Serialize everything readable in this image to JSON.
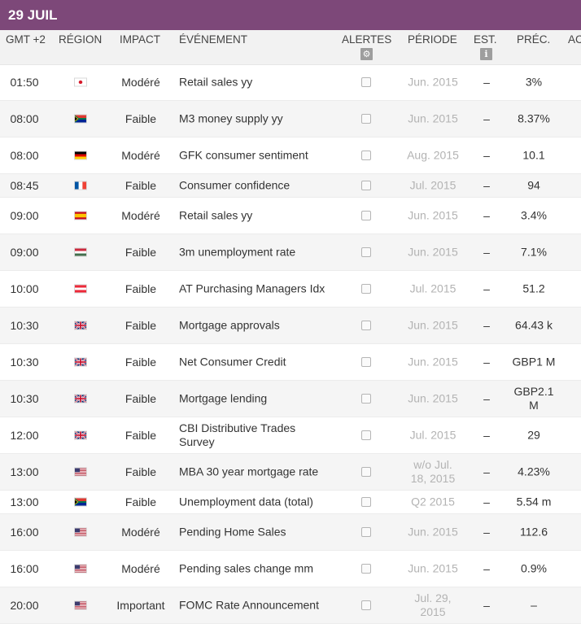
{
  "date_label": "29 JUIL",
  "columns": {
    "time": "GMT +2",
    "region": "RÉGION",
    "impact": "IMPACT",
    "event": "ÉVÉNEMENT",
    "alerts": "ALERTES",
    "period": "PÉRIODE",
    "estimate": "EST.",
    "previous": "PRÉC.",
    "actual": "AC"
  },
  "header_icons": {
    "alerts": "gear-icon",
    "estimate": "info-icon"
  },
  "rows": [
    {
      "time": "01:50",
      "flag": "japan",
      "impact": "Modéré",
      "event": "Retail sales yy",
      "period": "Jun. 2015",
      "estimate": "–",
      "previous": "3%"
    },
    {
      "time": "08:00",
      "flag": "south-africa",
      "impact": "Faible",
      "event": "M3 money supply yy",
      "period": "Jun. 2015",
      "estimate": "–",
      "previous": "8.37%"
    },
    {
      "time": "08:00",
      "flag": "germany",
      "impact": "Modéré",
      "event": "GFK consumer sentiment",
      "period": "Aug. 2015",
      "estimate": "–",
      "previous": "10.1"
    },
    {
      "time": "08:45",
      "flag": "france",
      "impact": "Faible",
      "event": "Consumer confidence",
      "period": "Jul. 2015",
      "estimate": "–",
      "previous": "94"
    },
    {
      "time": "09:00",
      "flag": "spain",
      "impact": "Modéré",
      "event": "Retail sales yy",
      "period": "Jun. 2015",
      "estimate": "–",
      "previous": "3.4%"
    },
    {
      "time": "09:00",
      "flag": "hungary",
      "impact": "Faible",
      "event": "3m unemployment rate",
      "period": "Jun. 2015",
      "estimate": "–",
      "previous": "7.1%"
    },
    {
      "time": "10:00",
      "flag": "austria",
      "impact": "Faible",
      "event": "AT Purchasing Managers Idx",
      "period": "Jul. 2015",
      "estimate": "–",
      "previous": "51.2"
    },
    {
      "time": "10:30",
      "flag": "united-kingdom",
      "impact": "Faible",
      "event": "Mortgage approvals",
      "period": "Jun. 2015",
      "estimate": "–",
      "previous": "64.43 k"
    },
    {
      "time": "10:30",
      "flag": "united-kingdom",
      "impact": "Faible",
      "event": "Net Consumer Credit",
      "period": "Jun. 2015",
      "estimate": "–",
      "previous": "GBP1 M"
    },
    {
      "time": "10:30",
      "flag": "united-kingdom",
      "impact": "Faible",
      "event": "Mortgage lending",
      "period": "Jun. 2015",
      "estimate": "–",
      "previous": "GBP2.1 M"
    },
    {
      "time": "12:00",
      "flag": "united-kingdom",
      "impact": "Faible",
      "event": "CBI Distributive Trades Survey",
      "period": "Jul. 2015",
      "estimate": "–",
      "previous": "29"
    },
    {
      "time": "13:00",
      "flag": "united-states",
      "impact": "Faible",
      "event": "MBA 30 year mortgage rate",
      "period": "w/o Jul. 18, 2015",
      "estimate": "–",
      "previous": "4.23%"
    },
    {
      "time": "13:00",
      "flag": "south-africa",
      "impact": "Faible",
      "event": "Unemployment data (total)",
      "period": "Q2 2015",
      "estimate": "–",
      "previous": "5.54 m"
    },
    {
      "time": "16:00",
      "flag": "united-states",
      "impact": "Modéré",
      "event": "Pending Home Sales",
      "period": "Jun. 2015",
      "estimate": "–",
      "previous": "112.6"
    },
    {
      "time": "16:00",
      "flag": "united-states",
      "impact": "Modéré",
      "event": "Pending sales change mm",
      "period": "Jun. 2015",
      "estimate": "–",
      "previous": "0.9%"
    },
    {
      "time": "20:00",
      "flag": "united-states",
      "impact": "Important",
      "event": "FOMC Rate Announcement",
      "period": "Jul. 29, 2015",
      "estimate": "–",
      "previous": "–"
    }
  ],
  "colors": {
    "date_bar": "#7d4879",
    "header_bg": "#f2f2f2",
    "row_alt": "#f5f5f5",
    "period_text": "#b3b3b3"
  }
}
